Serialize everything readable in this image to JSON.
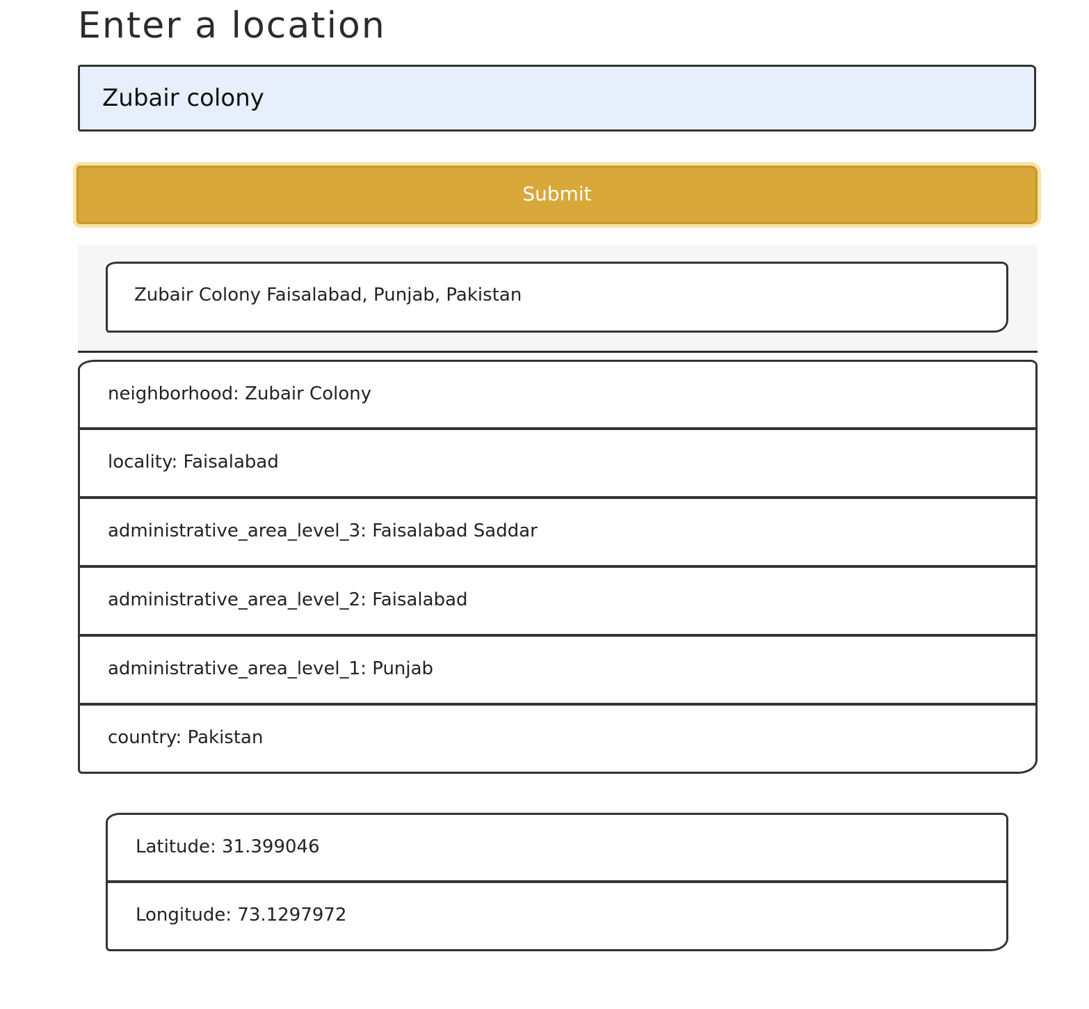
{
  "page": {
    "title": "Enter a location"
  },
  "search": {
    "value": "Zubair colony"
  },
  "submit": {
    "label": "Submit",
    "color": "#d8a83a"
  },
  "result": {
    "formatted_address": "Zubair Colony Faisalabad, Punjab, Pakistan",
    "components": [
      {
        "text": "neighborhood: Zubair Colony"
      },
      {
        "text": "locality: Faisalabad"
      },
      {
        "text": "administrative_area_level_3: Faisalabad Saddar"
      },
      {
        "text": "administrative_area_level_2: Faisalabad"
      },
      {
        "text": "administrative_area_level_1: Punjab"
      },
      {
        "text": "country: Pakistan"
      }
    ],
    "latitude": "Latitude: 31.399046",
    "longitude": "Longitude: 73.1297972"
  }
}
